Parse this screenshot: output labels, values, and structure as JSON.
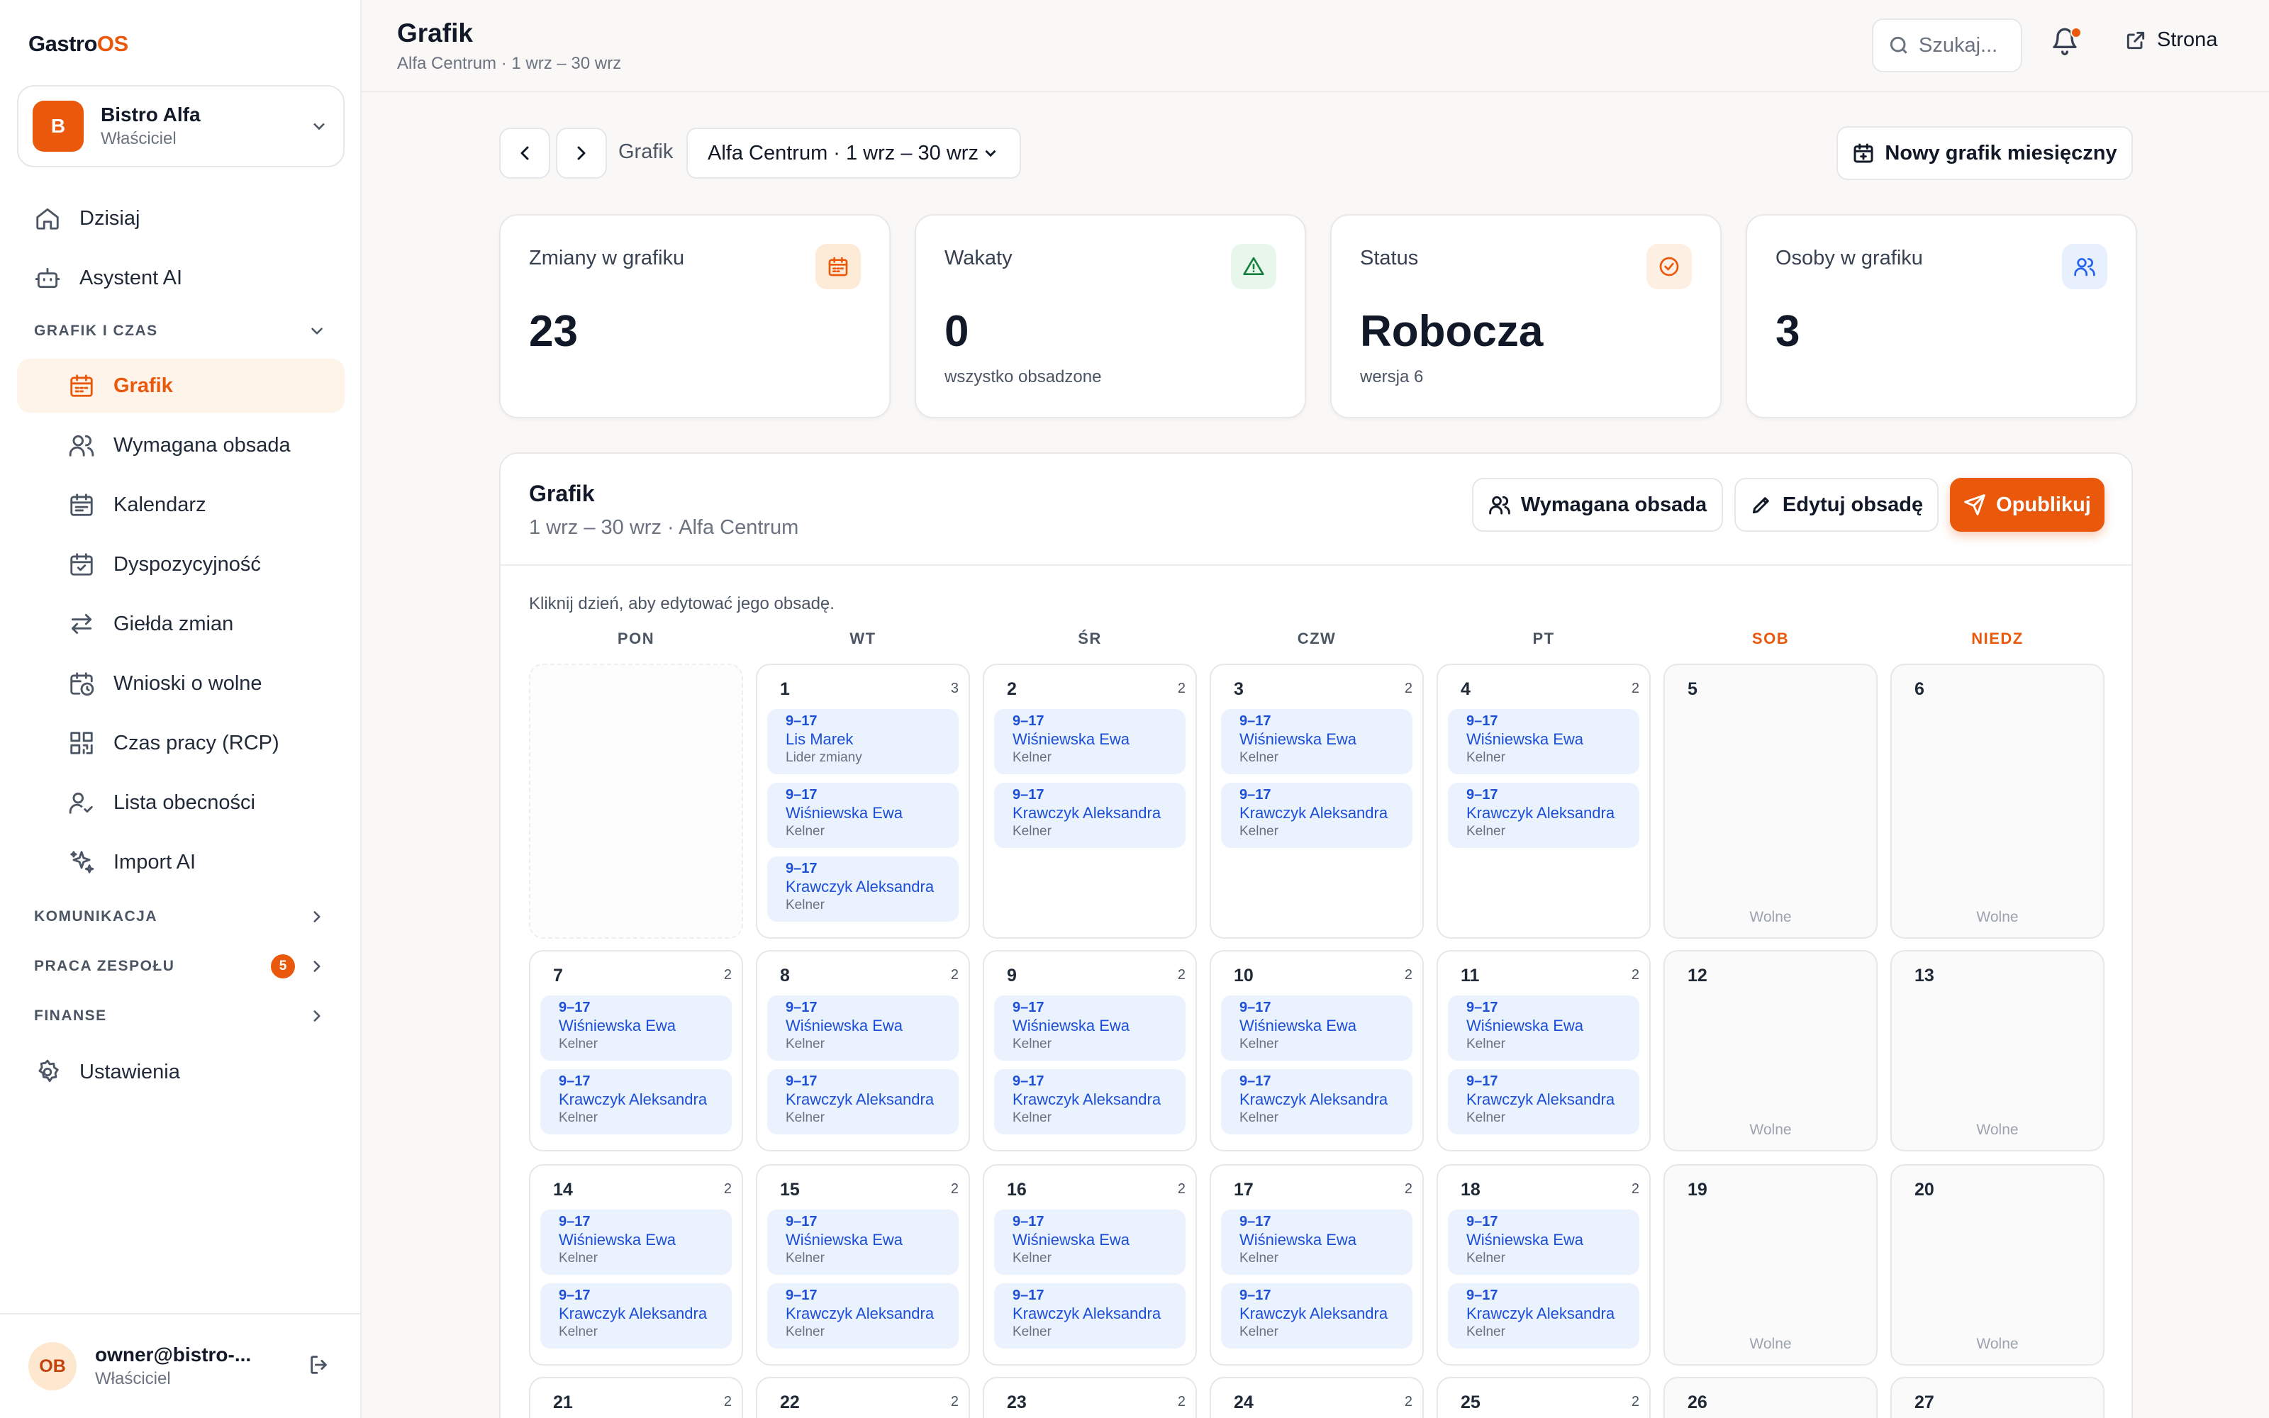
{
  "app": {
    "logo_main": "Gastro",
    "logo_accent": "OS"
  },
  "org": {
    "initial": "B",
    "name": "Bistro Alfa",
    "role": "Właściciel"
  },
  "nav": {
    "top": [
      {
        "label": "Dzisiaj"
      },
      {
        "label": "Asystent AI"
      }
    ],
    "section_schedule": "GRAFIK I CZAS",
    "schedule_items": [
      {
        "label": "Grafik"
      },
      {
        "label": "Wymagana obsada"
      },
      {
        "label": "Kalendarz"
      },
      {
        "label": "Dyspozycyjność"
      },
      {
        "label": "Giełda zmian"
      },
      {
        "label": "Wnioski o wolne"
      },
      {
        "label": "Czas pracy (RCP)"
      },
      {
        "label": "Lista obecności"
      },
      {
        "label": "Import AI"
      }
    ],
    "section_comm": "KOMUNIKACJA",
    "section_team": "PRACA ZESPOŁU",
    "team_badge": "5",
    "section_finance": "FINANSE",
    "settings": "Ustawienia"
  },
  "user": {
    "initials": "OB",
    "email": "owner@bistro-...",
    "role": "Właściciel"
  },
  "header": {
    "title": "Grafik",
    "subtitle": "Alfa Centrum · 1 wrz – 30 wrz",
    "search_placeholder": "Szukaj...",
    "site_link": "Strona"
  },
  "toolbar": {
    "label": "Grafik",
    "selected_schedule": "Alfa Centrum · 1 wrz – 30 wrz",
    "new_button": "Nowy grafik miesięczny"
  },
  "stats": [
    {
      "label": "Zmiany w grafiku",
      "value": "23",
      "sub": "",
      "icon": "calendar-icon",
      "color": "#ea580c",
      "bg": "#fdebd8"
    },
    {
      "label": "Wakaty",
      "value": "0",
      "sub": "wszystko obsadzone",
      "icon": "alert-triangle-icon",
      "color": "#15803d",
      "bg": "#e8f6ec"
    },
    {
      "label": "Status",
      "value": "Robocza",
      "sub": "wersja 6",
      "icon": "check-circle-icon",
      "color": "#ea580c",
      "bg": "#fdf0e3"
    },
    {
      "label": "Osoby w grafiku",
      "value": "3",
      "sub": "",
      "icon": "users-icon",
      "color": "#2563eb",
      "bg": "#e8f0fd"
    }
  ],
  "schedule": {
    "title": "Grafik",
    "subtitle": "1 wrz – 30 wrz · Alfa Centrum",
    "btn_required": "Wymagana obsada",
    "btn_edit": "Edytuj obsadę",
    "btn_publish": "Opublikuj",
    "hint": "Kliknij dzień, aby edytować jego obsadę.",
    "weekdays": [
      {
        "label": "PON",
        "weekend": false
      },
      {
        "label": "WT",
        "weekend": false
      },
      {
        "label": "ŚR",
        "weekend": false
      },
      {
        "label": "CZW",
        "weekend": false
      },
      {
        "label": "PT",
        "weekend": false
      },
      {
        "label": "SOB",
        "weekend": true
      },
      {
        "label": "NIEDZ",
        "weekend": true
      }
    ],
    "off_label": "Wolne",
    "weeks": [
      [
        {
          "empty": true
        },
        {
          "day": "1",
          "count": "3",
          "shifts": [
            {
              "time": "9–17",
              "name": "Lis Marek",
              "role": "Lider zmiany"
            },
            {
              "time": "9–17",
              "name": "Wiśniewska Ewa",
              "role": "Kelner"
            },
            {
              "time": "9–17",
              "name": "Krawczyk Aleksandra",
              "role": "Kelner"
            }
          ]
        },
        {
          "day": "2",
          "count": "2",
          "shifts": [
            {
              "time": "9–17",
              "name": "Wiśniewska Ewa",
              "role": "Kelner"
            },
            {
              "time": "9–17",
              "name": "Krawczyk Aleksandra",
              "role": "Kelner"
            }
          ]
        },
        {
          "day": "3",
          "count": "2",
          "shifts": [
            {
              "time": "9–17",
              "name": "Wiśniewska Ewa",
              "role": "Kelner"
            },
            {
              "time": "9–17",
              "name": "Krawczyk Aleksandra",
              "role": "Kelner"
            }
          ]
        },
        {
          "day": "4",
          "count": "2",
          "shifts": [
            {
              "time": "9–17",
              "name": "Wiśniewska Ewa",
              "role": "Kelner"
            },
            {
              "time": "9–17",
              "name": "Krawczyk Aleksandra",
              "role": "Kelner"
            }
          ]
        },
        {
          "day": "5",
          "off": true,
          "shifts": []
        },
        {
          "day": "6",
          "off": true,
          "shifts": []
        }
      ],
      [
        {
          "day": "7",
          "count": "2",
          "shifts": [
            {
              "time": "9–17",
              "name": "Wiśniewska Ewa",
              "role": "Kelner"
            },
            {
              "time": "9–17",
              "name": "Krawczyk Aleksandra",
              "role": "Kelner"
            }
          ]
        },
        {
          "day": "8",
          "count": "2",
          "shifts": [
            {
              "time": "9–17",
              "name": "Wiśniewska Ewa",
              "role": "Kelner"
            },
            {
              "time": "9–17",
              "name": "Krawczyk Aleksandra",
              "role": "Kelner"
            }
          ]
        },
        {
          "day": "9",
          "count": "2",
          "shifts": [
            {
              "time": "9–17",
              "name": "Wiśniewska Ewa",
              "role": "Kelner"
            },
            {
              "time": "9–17",
              "name": "Krawczyk Aleksandra",
              "role": "Kelner"
            }
          ]
        },
        {
          "day": "10",
          "count": "2",
          "shifts": [
            {
              "time": "9–17",
              "name": "Wiśniewska Ewa",
              "role": "Kelner"
            },
            {
              "time": "9–17",
              "name": "Krawczyk Aleksandra",
              "role": "Kelner"
            }
          ]
        },
        {
          "day": "11",
          "count": "2",
          "shifts": [
            {
              "time": "9–17",
              "name": "Wiśniewska Ewa",
              "role": "Kelner"
            },
            {
              "time": "9–17",
              "name": "Krawczyk Aleksandra",
              "role": "Kelner"
            }
          ]
        },
        {
          "day": "12",
          "off": true,
          "shifts": []
        },
        {
          "day": "13",
          "off": true,
          "shifts": []
        }
      ],
      [
        {
          "day": "14",
          "count": "2",
          "shifts": [
            {
              "time": "9–17",
              "name": "Wiśniewska Ewa",
              "role": "Kelner"
            },
            {
              "time": "9–17",
              "name": "Krawczyk Aleksandra",
              "role": "Kelner"
            }
          ]
        },
        {
          "day": "15",
          "count": "2",
          "shifts": [
            {
              "time": "9–17",
              "name": "Wiśniewska Ewa",
              "role": "Kelner"
            },
            {
              "time": "9–17",
              "name": "Krawczyk Aleksandra",
              "role": "Kelner"
            }
          ]
        },
        {
          "day": "16",
          "count": "2",
          "shifts": [
            {
              "time": "9–17",
              "name": "Wiśniewska Ewa",
              "role": "Kelner"
            },
            {
              "time": "9–17",
              "name": "Krawczyk Aleksandra",
              "role": "Kelner"
            }
          ]
        },
        {
          "day": "17",
          "count": "2",
          "shifts": [
            {
              "time": "9–17",
              "name": "Wiśniewska Ewa",
              "role": "Kelner"
            },
            {
              "time": "9–17",
              "name": "Krawczyk Aleksandra",
              "role": "Kelner"
            }
          ]
        },
        {
          "day": "18",
          "count": "2",
          "shifts": [
            {
              "time": "9–17",
              "name": "Wiśniewska Ewa",
              "role": "Kelner"
            },
            {
              "time": "9–17",
              "name": "Krawczyk Aleksandra",
              "role": "Kelner"
            }
          ]
        },
        {
          "day": "19",
          "off": true,
          "shifts": []
        },
        {
          "day": "20",
          "off": true,
          "shifts": []
        }
      ],
      [
        {
          "day": "21",
          "count": "2",
          "shifts": []
        },
        {
          "day": "22",
          "count": "2",
          "shifts": []
        },
        {
          "day": "23",
          "count": "2",
          "shifts": []
        },
        {
          "day": "24",
          "count": "2",
          "shifts": []
        },
        {
          "day": "25",
          "count": "2",
          "shifts": []
        },
        {
          "day": "26",
          "shifts": []
        },
        {
          "day": "27",
          "shifts": []
        }
      ]
    ]
  }
}
